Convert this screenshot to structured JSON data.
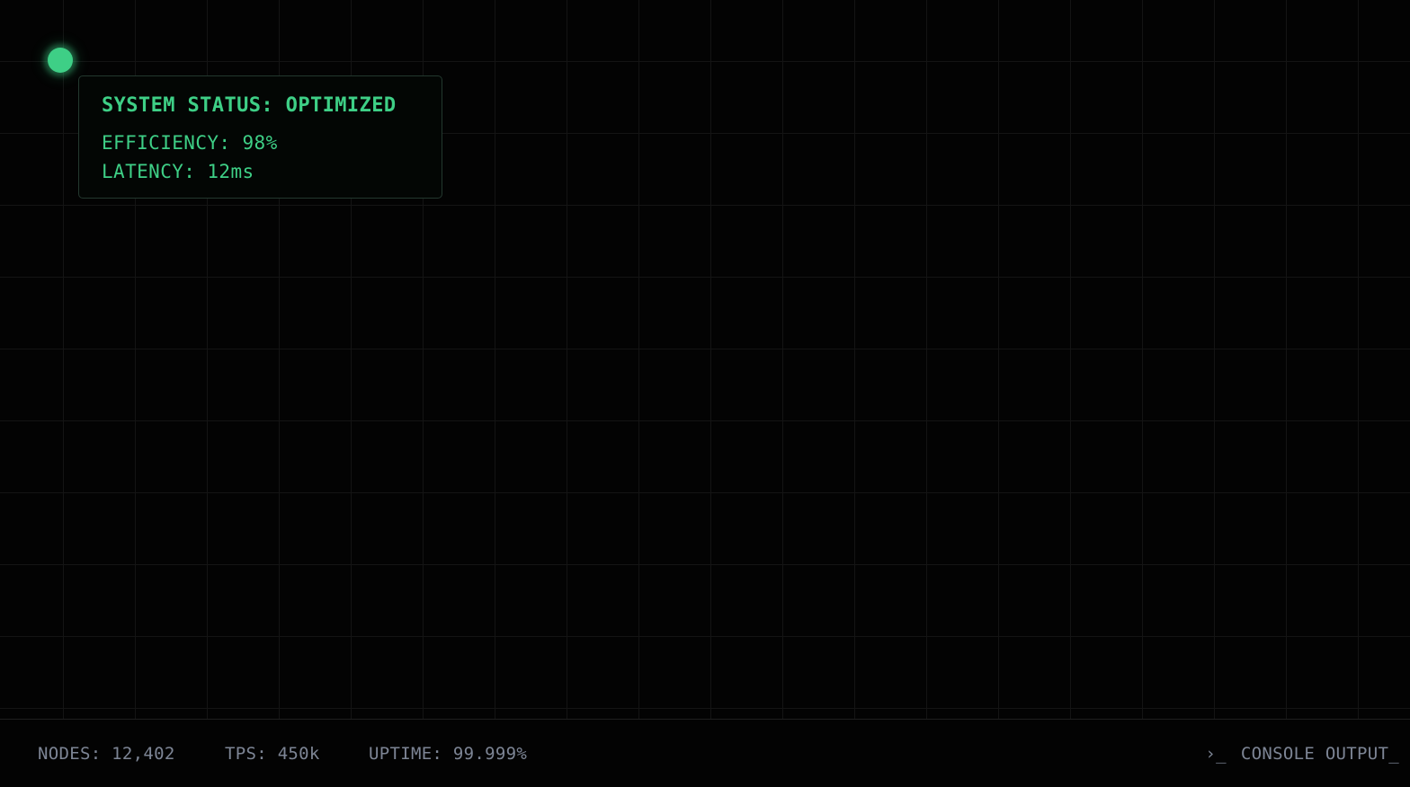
{
  "status": {
    "title": "SYSTEM STATUS: OPTIMIZED",
    "efficiency": "EFFICIENCY: 98%",
    "latency": "LATENCY: 12ms",
    "indicator_color": "#3ecf86"
  },
  "footer": {
    "nodes": "NODES: 12,402",
    "tps": "TPS: 450k",
    "uptime": "UPTIME: 99.999%",
    "console_icon": "terminal-prompt-icon",
    "console_prompt": "›_",
    "console_label": "CONSOLE OUTPUT_"
  }
}
